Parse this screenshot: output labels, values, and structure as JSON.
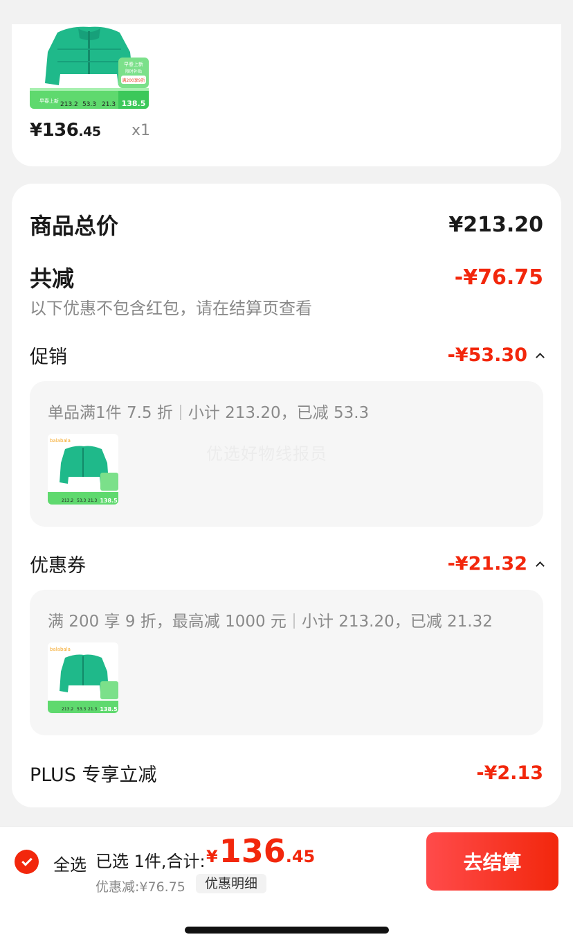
{
  "item": {
    "price_int": "¥136",
    "price_dec": ".45",
    "qty": "x1",
    "image_text": {
      "tag1": "早春上新",
      "tag2": "限时补贴",
      "tag3": "满200享9折",
      "bar_left": "早春上新",
      "n1": "213.2",
      "n2": "53.3",
      "n3": "21.3",
      "final": "138.5",
      "brand": "balabala"
    }
  },
  "summary": {
    "total_label": "商品总价",
    "total_value": "¥213.20",
    "reduce_label": "共减",
    "reduce_value": "-¥76.75",
    "note": "以下优惠不包含红包，请在结算页查看"
  },
  "promo": {
    "label": "促销",
    "value": "-¥53.30",
    "rule": "单品满1件 7.5 折",
    "sub": "小计 213.20，已减 53.3",
    "watermark": "优选好物线报员"
  },
  "coupon": {
    "label": "优惠券",
    "value": "-¥21.32",
    "rule": "满 200 享 9 折，最高减 1000 元",
    "sub": "小计 213.20，已减 21.32"
  },
  "plus": {
    "label": "PLUS 专享立减",
    "value": "-¥2.13"
  },
  "bottom": {
    "select_all": "全选",
    "selected": "已选 1件,合计:",
    "total_cur": "¥",
    "total_int": "136",
    "total_dec": ".45",
    "discount": "优惠减:¥76.75",
    "detail": "优惠明细",
    "checkout": "去结算"
  },
  "colors": {
    "accent": "#f2270c",
    "jacket": "#1fb98a",
    "banner": "#4cd964"
  }
}
